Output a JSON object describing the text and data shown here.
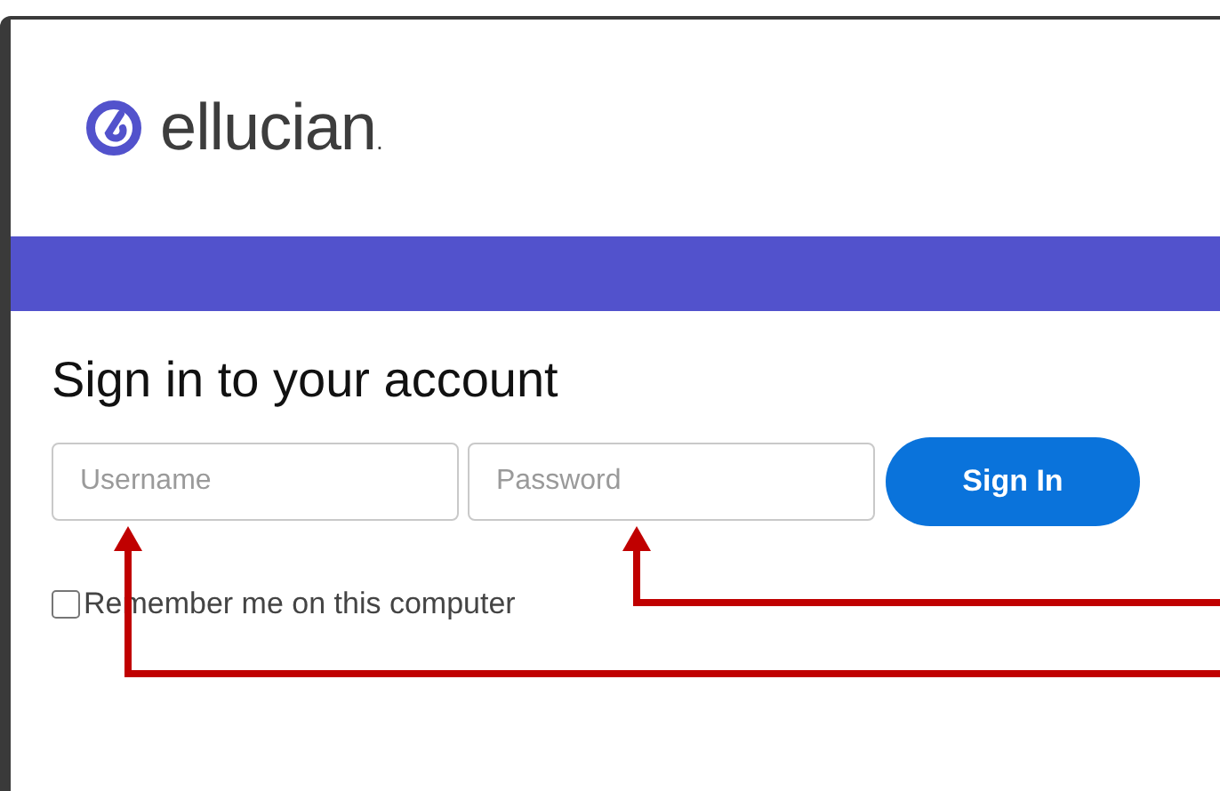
{
  "brand": {
    "name": "ellucian",
    "mark": "."
  },
  "heading": "Sign in to your account",
  "fields": [
    {
      "placeholder": "Username"
    },
    {
      "placeholder": "Password"
    }
  ],
  "button": "Sign In",
  "remember": {
    "label": "Remember me on this computer",
    "checked": false
  }
}
